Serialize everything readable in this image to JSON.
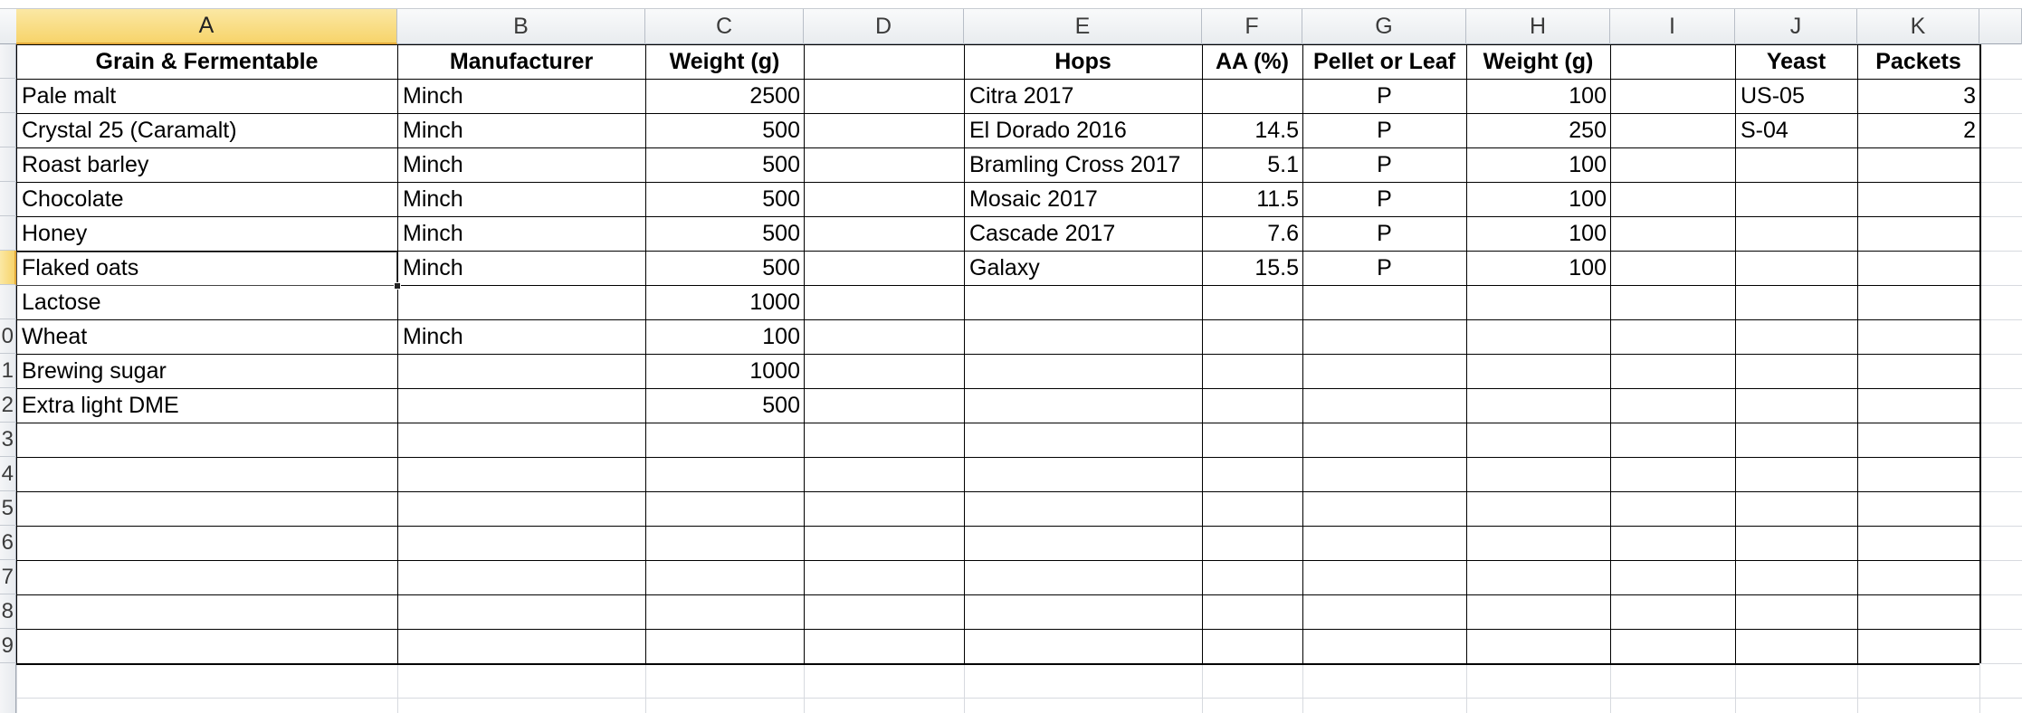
{
  "sheet": {
    "columns": [
      "A",
      "B",
      "C",
      "D",
      "E",
      "F",
      "G",
      "H",
      "I",
      "J",
      "K"
    ],
    "selected_column": "A",
    "row_labels": [
      "",
      "",
      "",
      "",
      "",
      "",
      "",
      "",
      "0",
      "1",
      "2",
      "3",
      "4",
      "5",
      "6",
      "7",
      "8",
      "9"
    ],
    "header_row": [
      "Grain & Fermentable",
      "Manufacturer",
      "Weight (g)",
      "",
      "Hops",
      "AA (%)",
      "Pellet or Leaf",
      "Weight (g)",
      "",
      "Yeast",
      "Packets"
    ],
    "rows": [
      [
        "Pale malt",
        "Minch",
        "2500",
        "",
        "Citra 2017",
        "",
        "P",
        "100",
        "",
        "US-05",
        "3"
      ],
      [
        "Crystal 25 (Caramalt)",
        "Minch",
        "500",
        "",
        "El Dorado 2016",
        "14.5",
        "P",
        "250",
        "",
        "S-04",
        "2"
      ],
      [
        "Roast barley",
        "Minch",
        "500",
        "",
        "Bramling Cross 2017",
        "5.1",
        "P",
        "100",
        "",
        "",
        ""
      ],
      [
        "Chocolate",
        "Minch",
        "500",
        "",
        "Mosaic 2017",
        "11.5",
        "P",
        "100",
        "",
        "",
        ""
      ],
      [
        "Honey",
        "Minch",
        "500",
        "",
        "Cascade 2017",
        "7.6",
        "P",
        "100",
        "",
        "",
        ""
      ],
      [
        "Flaked oats",
        "Minch",
        "500",
        "",
        "Galaxy",
        "15.5",
        "P",
        "100",
        "",
        "",
        ""
      ],
      [
        "Lactose",
        "",
        "1000",
        "",
        "",
        "",
        "",
        "",
        "",
        "",
        ""
      ],
      [
        "Wheat",
        "Minch",
        "100",
        "",
        "",
        "",
        "",
        "",
        "",
        "",
        ""
      ],
      [
        "Brewing sugar",
        "",
        "1000",
        "",
        "",
        "",
        "",
        "",
        "",
        "",
        ""
      ],
      [
        "Extra light DME",
        "",
        "500",
        "",
        "",
        "",
        "",
        "",
        "",
        "",
        ""
      ],
      [
        "",
        "",
        "",
        "",
        "",
        "",
        "",
        "",
        "",
        "",
        ""
      ],
      [
        "",
        "",
        "",
        "",
        "",
        "",
        "",
        "",
        "",
        "",
        ""
      ],
      [
        "",
        "",
        "",
        "",
        "",
        "",
        "",
        "",
        "",
        "",
        ""
      ],
      [
        "",
        "",
        "",
        "",
        "",
        "",
        "",
        "",
        "",
        "",
        ""
      ],
      [
        "",
        "",
        "",
        "",
        "",
        "",
        "",
        "",
        "",
        "",
        ""
      ],
      [
        "",
        "",
        "",
        "",
        "",
        "",
        "",
        "",
        "",
        "",
        ""
      ],
      [
        "",
        "",
        "",
        "",
        "",
        "",
        "",
        "",
        "",
        "",
        ""
      ]
    ]
  }
}
